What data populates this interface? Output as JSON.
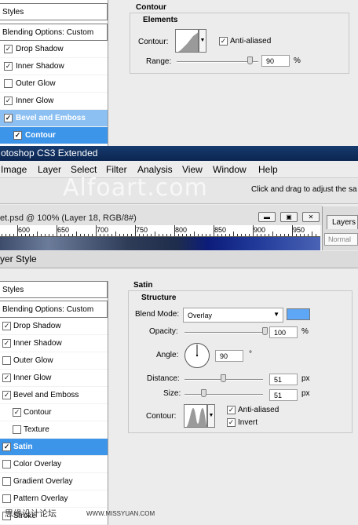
{
  "top_dialog": {
    "styles_header": "Styles",
    "blending_options": "Blending Options: Custom",
    "items": [
      {
        "label": "Drop Shadow",
        "checked": true
      },
      {
        "label": "Inner Shadow",
        "checked": true
      },
      {
        "label": "Outer Glow",
        "checked": false
      },
      {
        "label": "Inner Glow",
        "checked": true
      },
      {
        "label": "Bevel and Emboss",
        "checked": true
      },
      {
        "label": "Contour",
        "checked": true
      }
    ],
    "panel_title": "Contour",
    "group_title": "Elements",
    "contour_label": "Contour:",
    "anti_aliased_label": "Anti-aliased",
    "anti_aliased_checked": true,
    "range_label": "Range:",
    "range_value": "90",
    "range_unit": "%",
    "range_fraction": 0.9
  },
  "photoshop": {
    "window_title": "otoshop CS3 Extended",
    "menu": [
      "Image",
      "Layer",
      "Select",
      "Filter",
      "Analysis",
      "View",
      "Window",
      "Help"
    ],
    "watermark": "Alfoart.com",
    "options_hint": "Click and drag to adjust the sa",
    "document_title": "et.psd @ 100% (Layer 18, RGB/8#)",
    "ruler_numbers": [
      "600",
      "650",
      "700",
      "750",
      "800",
      "850",
      "900",
      "950"
    ],
    "layers_tab": "Layers",
    "layers_blend": "Normal",
    "minimize_icon": "minimize-icon",
    "restore_icon": "restore-icon",
    "close_icon": "close-icon"
  },
  "bottom_dialog": {
    "title": "yer Style",
    "styles_header": "Styles",
    "blending_options": "Blending Options: Custom",
    "items": [
      {
        "label": "Drop Shadow",
        "checked": true
      },
      {
        "label": "Inner Shadow",
        "checked": true
      },
      {
        "label": "Outer Glow",
        "checked": false
      },
      {
        "label": "Inner Glow",
        "checked": true
      },
      {
        "label": "Bevel and Emboss",
        "checked": true
      },
      {
        "label": "Contour",
        "checked": true
      },
      {
        "label": "Texture",
        "checked": false
      },
      {
        "label": "Satin",
        "checked": true
      },
      {
        "label": "Color Overlay",
        "checked": false
      },
      {
        "label": "Gradient Overlay",
        "checked": false
      },
      {
        "label": "Pattern Overlay",
        "checked": false
      },
      {
        "label": "Stroke",
        "checked": false
      }
    ],
    "panel_title": "Satin",
    "group_title": "Structure",
    "blend_mode_label": "Blend Mode:",
    "blend_mode_value": "Overlay",
    "satin_color": "#5ea6f6",
    "opacity_label": "Opacity:",
    "opacity_value": "100",
    "opacity_unit": "%",
    "opacity_fraction": 1.0,
    "angle_label": "Angle:",
    "angle_value": "90",
    "angle_unit": "°",
    "distance_label": "Distance:",
    "distance_value": "51",
    "distance_unit": "px",
    "distance_fraction": 0.5,
    "size_label": "Size:",
    "size_value": "51",
    "size_unit": "px",
    "size_fraction": 0.25,
    "contour_label": "Contour:",
    "anti_aliased_label": "Anti-aliased",
    "anti_aliased_checked": true,
    "invert_label": "Invert",
    "invert_checked": true
  },
  "footer_watermark": "思缘设计论坛",
  "footer_url": "WWW.MISSYUAN.COM",
  "colors": {
    "selection": "#3d95ea",
    "selection_light": "#8cc0f2",
    "titlebar": "#173b6e"
  }
}
